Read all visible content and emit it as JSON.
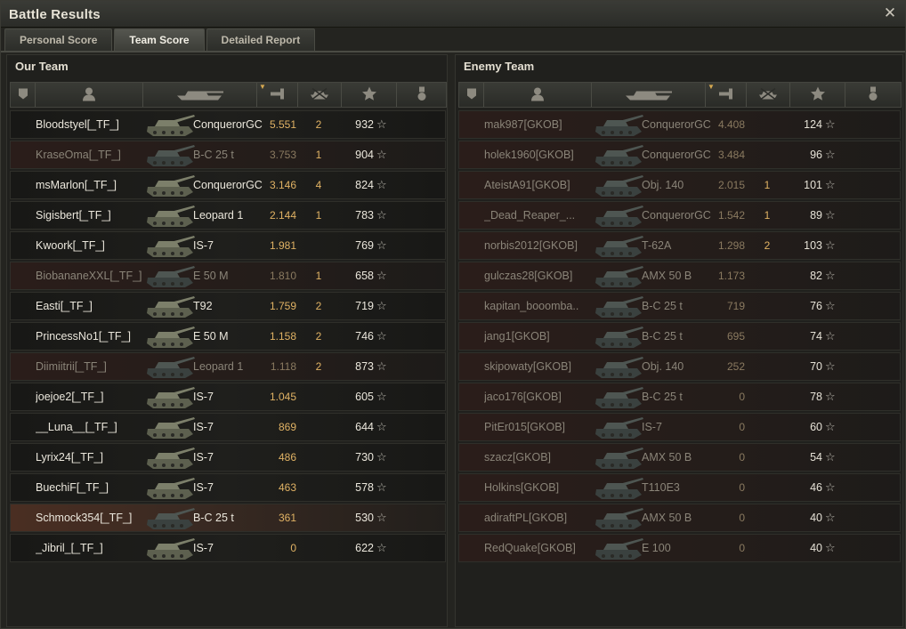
{
  "window": {
    "title": "Battle Results",
    "close_icon": "close-icon"
  },
  "tabs": [
    "Personal Score",
    "Team Score",
    "Detailed Report"
  ],
  "active_tab": 1,
  "our_team": {
    "title": "Our Team",
    "rows": [
      {
        "player": "Bloodstyel[_TF_]",
        "tank": "ConquerorGC",
        "damage": "5.551",
        "kills": "2",
        "xp": "932",
        "state": "alive"
      },
      {
        "player": "KraseOma[_TF_]",
        "tank": "B-C 25 t",
        "damage": "3.753",
        "kills": "1",
        "xp": "904",
        "state": "dead"
      },
      {
        "player": "msMarlon[_TF_]",
        "tank": "ConquerorGC",
        "damage": "3.146",
        "kills": "4",
        "xp": "824",
        "state": "alive"
      },
      {
        "player": "Sigisbert[_TF_]",
        "tank": "Leopard 1",
        "damage": "2.144",
        "kills": "1",
        "xp": "783",
        "state": "alive"
      },
      {
        "player": "Kwoork[_TF_]",
        "tank": "IS-7",
        "damage": "1.981",
        "kills": "",
        "xp": "769",
        "state": "alive"
      },
      {
        "player": "BiobananeXXL[_TF_]",
        "tank": "E 50 M",
        "damage": "1.810",
        "kills": "1",
        "xp": "658",
        "state": "dead"
      },
      {
        "player": "Easti[_TF_]",
        "tank": "T92",
        "damage": "1.759",
        "kills": "2",
        "xp": "719",
        "state": "alive"
      },
      {
        "player": "PrincessNo1[_TF_]",
        "tank": "E 50 M",
        "damage": "1.158",
        "kills": "2",
        "xp": "746",
        "state": "alive"
      },
      {
        "player": "Diimiitrii[_TF_]",
        "tank": "Leopard 1",
        "damage": "1.118",
        "kills": "2",
        "xp": "873",
        "state": "dead"
      },
      {
        "player": "joejoe2[_TF_]",
        "tank": "IS-7",
        "damage": "1.045",
        "kills": "",
        "xp": "605",
        "state": "alive"
      },
      {
        "player": "__Luna__[_TF_]",
        "tank": "IS-7",
        "damage": "869",
        "kills": "",
        "xp": "644",
        "state": "alive"
      },
      {
        "player": "Lyrix24[_TF_]",
        "tank": "IS-7",
        "damage": "486",
        "kills": "",
        "xp": "730",
        "state": "alive"
      },
      {
        "player": "BuechiF[_TF_]",
        "tank": "IS-7",
        "damage": "463",
        "kills": "",
        "xp": "578",
        "state": "alive"
      },
      {
        "player": "Schmock354[_TF_]",
        "tank": "B-C 25 t",
        "damage": "361",
        "kills": "",
        "xp": "530",
        "state": "highlight"
      },
      {
        "player": "_Jibril_[_TF_]",
        "tank": "IS-7",
        "damage": "0",
        "kills": "",
        "xp": "622",
        "state": "alive"
      }
    ]
  },
  "enemy_team": {
    "title": "Enemy Team",
    "rows": [
      {
        "player": "mak987[GKOB]",
        "tank": "ConquerorGC",
        "damage": "4.408",
        "kills": "",
        "xp": "124",
        "state": "dead"
      },
      {
        "player": "holek1960[GKOB]",
        "tank": "ConquerorGC",
        "damage": "3.484",
        "kills": "",
        "xp": "96",
        "state": "dead"
      },
      {
        "player": "AteistA91[GKOB]",
        "tank": "Obj. 140",
        "damage": "2.015",
        "kills": "1",
        "xp": "101",
        "state": "dead"
      },
      {
        "player": "_Dead_Reaper_...",
        "tank": "ConquerorGC",
        "damage": "1.542",
        "kills": "1",
        "xp": "89",
        "state": "dead"
      },
      {
        "player": "norbis2012[GKOB]",
        "tank": "T-62A",
        "damage": "1.298",
        "kills": "2",
        "xp": "103",
        "state": "dead"
      },
      {
        "player": "gulczas28[GKOB]",
        "tank": "AMX 50 B",
        "damage": "1.173",
        "kills": "",
        "xp": "82",
        "state": "dead"
      },
      {
        "player": "kapitan_booomba..",
        "tank": "B-C 25 t",
        "damage": "719",
        "kills": "",
        "xp": "76",
        "state": "dead"
      },
      {
        "player": "jang1[GKOB]",
        "tank": "B-C 25 t",
        "damage": "695",
        "kills": "",
        "xp": "74",
        "state": "dead"
      },
      {
        "player": "skipowaty[GKOB]",
        "tank": "Obj. 140",
        "damage": "252",
        "kills": "",
        "xp": "70",
        "state": "dead"
      },
      {
        "player": "jaco176[GKOB]",
        "tank": "B-C 25 t",
        "damage": "0",
        "kills": "",
        "xp": "78",
        "state": "dead"
      },
      {
        "player": "PitEr015[GKOB]",
        "tank": "IS-7",
        "damage": "0",
        "kills": "",
        "xp": "60",
        "state": "dead"
      },
      {
        "player": "szacz[GKOB]",
        "tank": "AMX 50 B",
        "damage": "0",
        "kills": "",
        "xp": "54",
        "state": "dead"
      },
      {
        "player": "Holkins[GKOB]",
        "tank": "T110E3",
        "damage": "0",
        "kills": "",
        "xp": "46",
        "state": "dead"
      },
      {
        "player": "adiraftPL[GKOB]",
        "tank": "AMX 50 B",
        "damage": "0",
        "kills": "",
        "xp": "40",
        "state": "dead"
      },
      {
        "player": "RedQuake[GKOB]",
        "tank": "E 100",
        "damage": "0",
        "kills": "",
        "xp": "40",
        "state": "dead"
      }
    ]
  },
  "colors": {
    "damage": "#e0b264",
    "kills": "#e0b264",
    "sort_arrow": "#d6a951"
  }
}
